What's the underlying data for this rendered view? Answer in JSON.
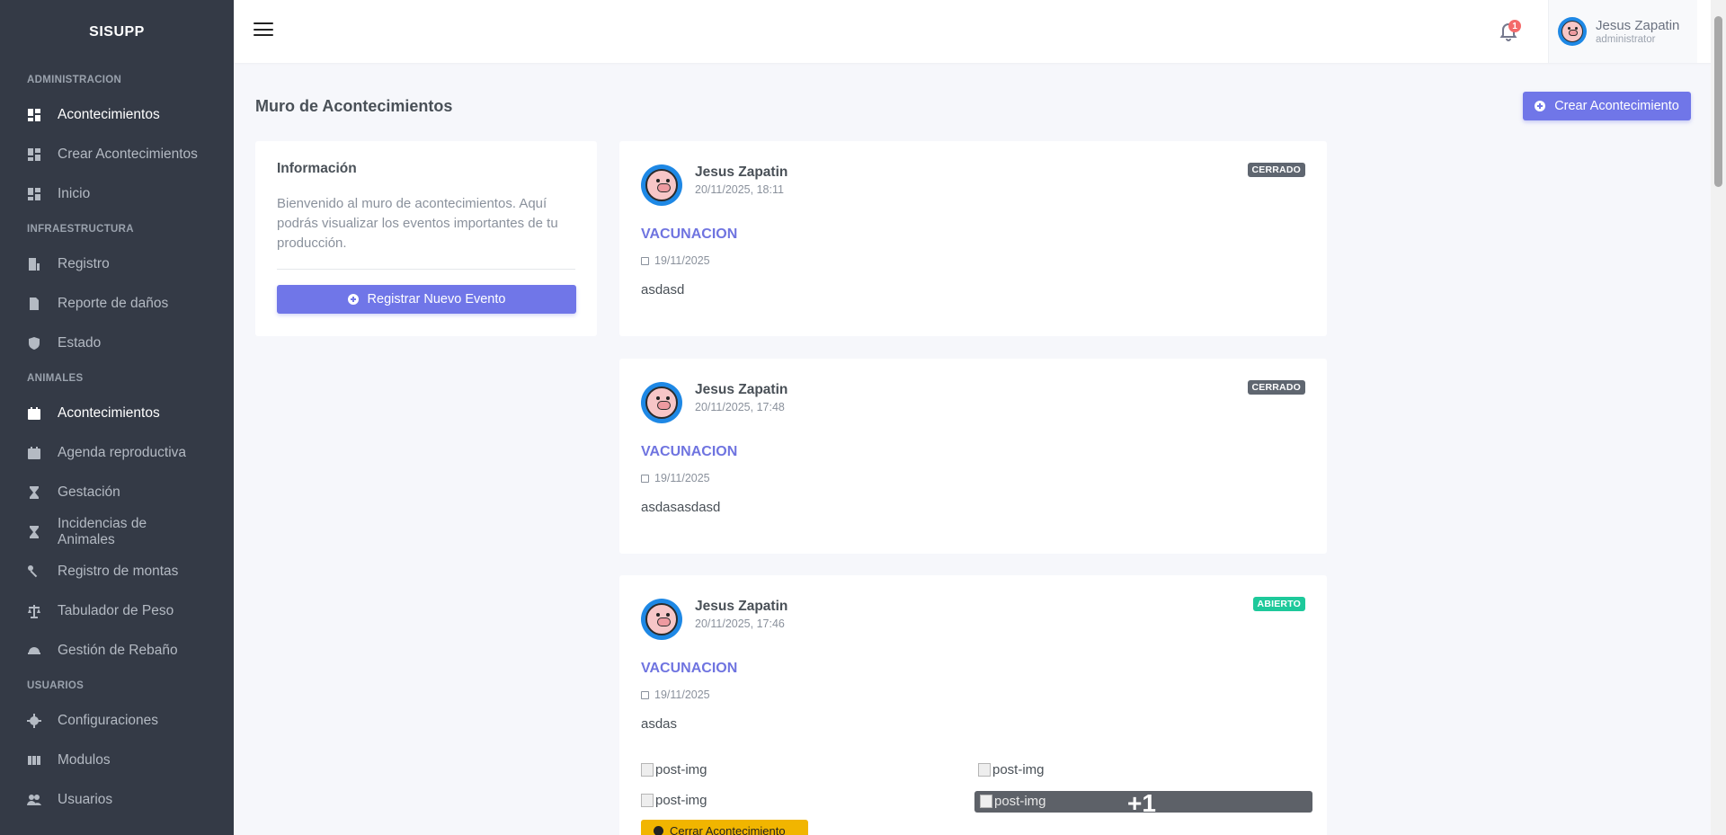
{
  "app": {
    "brand": "SISUPP"
  },
  "sidebar": {
    "sections": [
      {
        "title": "ADMINISTRACION",
        "items": [
          {
            "label": "Acontecimientos",
            "icon": "dashboard-icon",
            "active": true
          },
          {
            "label": "Crear Acontecimientos",
            "icon": "dashboard-icon",
            "active": false
          },
          {
            "label": "Inicio",
            "icon": "dashboard-icon",
            "active": false
          }
        ]
      },
      {
        "title": "INFRAESTRUCTURA",
        "items": [
          {
            "label": "Registro",
            "icon": "building-icon",
            "active": false
          },
          {
            "label": "Reporte de daños",
            "icon": "document-icon",
            "active": false
          },
          {
            "label": "Estado",
            "icon": "shield-check-icon",
            "active": false
          }
        ]
      },
      {
        "title": "ANIMALES",
        "items": [
          {
            "label": "Acontecimientos",
            "icon": "calendar-icon",
            "active": true
          },
          {
            "label": "Agenda reproductiva",
            "icon": "calendar-icon",
            "active": false
          },
          {
            "label": "Gestación",
            "icon": "hourglass-icon",
            "active": false
          },
          {
            "label": "Incidencias de Animales",
            "icon": "hourglass-icon",
            "active": false
          },
          {
            "label": "Registro de montas",
            "icon": "link-icon",
            "active": false
          },
          {
            "label": "Tabulador de Peso",
            "icon": "scale-icon",
            "active": false
          },
          {
            "label": "Gestión de Rebaño",
            "icon": "helmet-icon",
            "active": false
          }
        ]
      },
      {
        "title": "USUARIOS",
        "items": [
          {
            "label": "Configuraciones",
            "icon": "gear-icon",
            "active": false
          },
          {
            "label": "Modulos",
            "icon": "grid-icon",
            "active": false
          },
          {
            "label": "Usuarios",
            "icon": "users-icon",
            "active": false
          }
        ]
      }
    ]
  },
  "topbar": {
    "notification_count": "1",
    "user": {
      "name": "Jesus Zapatin",
      "role": "administrator"
    }
  },
  "page": {
    "title": "Muro de Acontecimientos",
    "create_button": "Crear Acontecimiento"
  },
  "info_card": {
    "title": "Información",
    "text": "Bienvenido al muro de acontecimientos. Aquí podrás visualizar los eventos importantes de tu producción.",
    "button": "Registrar Nuevo Evento"
  },
  "posts": [
    {
      "author": "Jesus Zapatin",
      "time": "20/11/2025, 18:11",
      "status": "CERRADO",
      "type": "VACUNACION",
      "date": "19/11/2025",
      "description": "asdasd"
    },
    {
      "author": "Jesus Zapatin",
      "time": "20/11/2025, 17:48",
      "status": "CERRADO",
      "type": "VACUNACION",
      "date": "19/11/2025",
      "description": "asdasasdasd"
    },
    {
      "author": "Jesus Zapatin",
      "time": "20/11/2025, 17:46",
      "status": "ABIERTO",
      "type": "VACUNACION",
      "date": "19/11/2025",
      "description": "asdas",
      "images": [
        "post-img",
        "post-img",
        "post-img",
        "post-img"
      ],
      "more_images": "+1",
      "close_button": "Cerrar Acontecimiento"
    }
  ],
  "colors": {
    "sidebar_bg": "#343a46",
    "primary": "#7076e8",
    "closed": "#5f6670",
    "open": "#1ec99b",
    "warning": "#f1b500"
  }
}
